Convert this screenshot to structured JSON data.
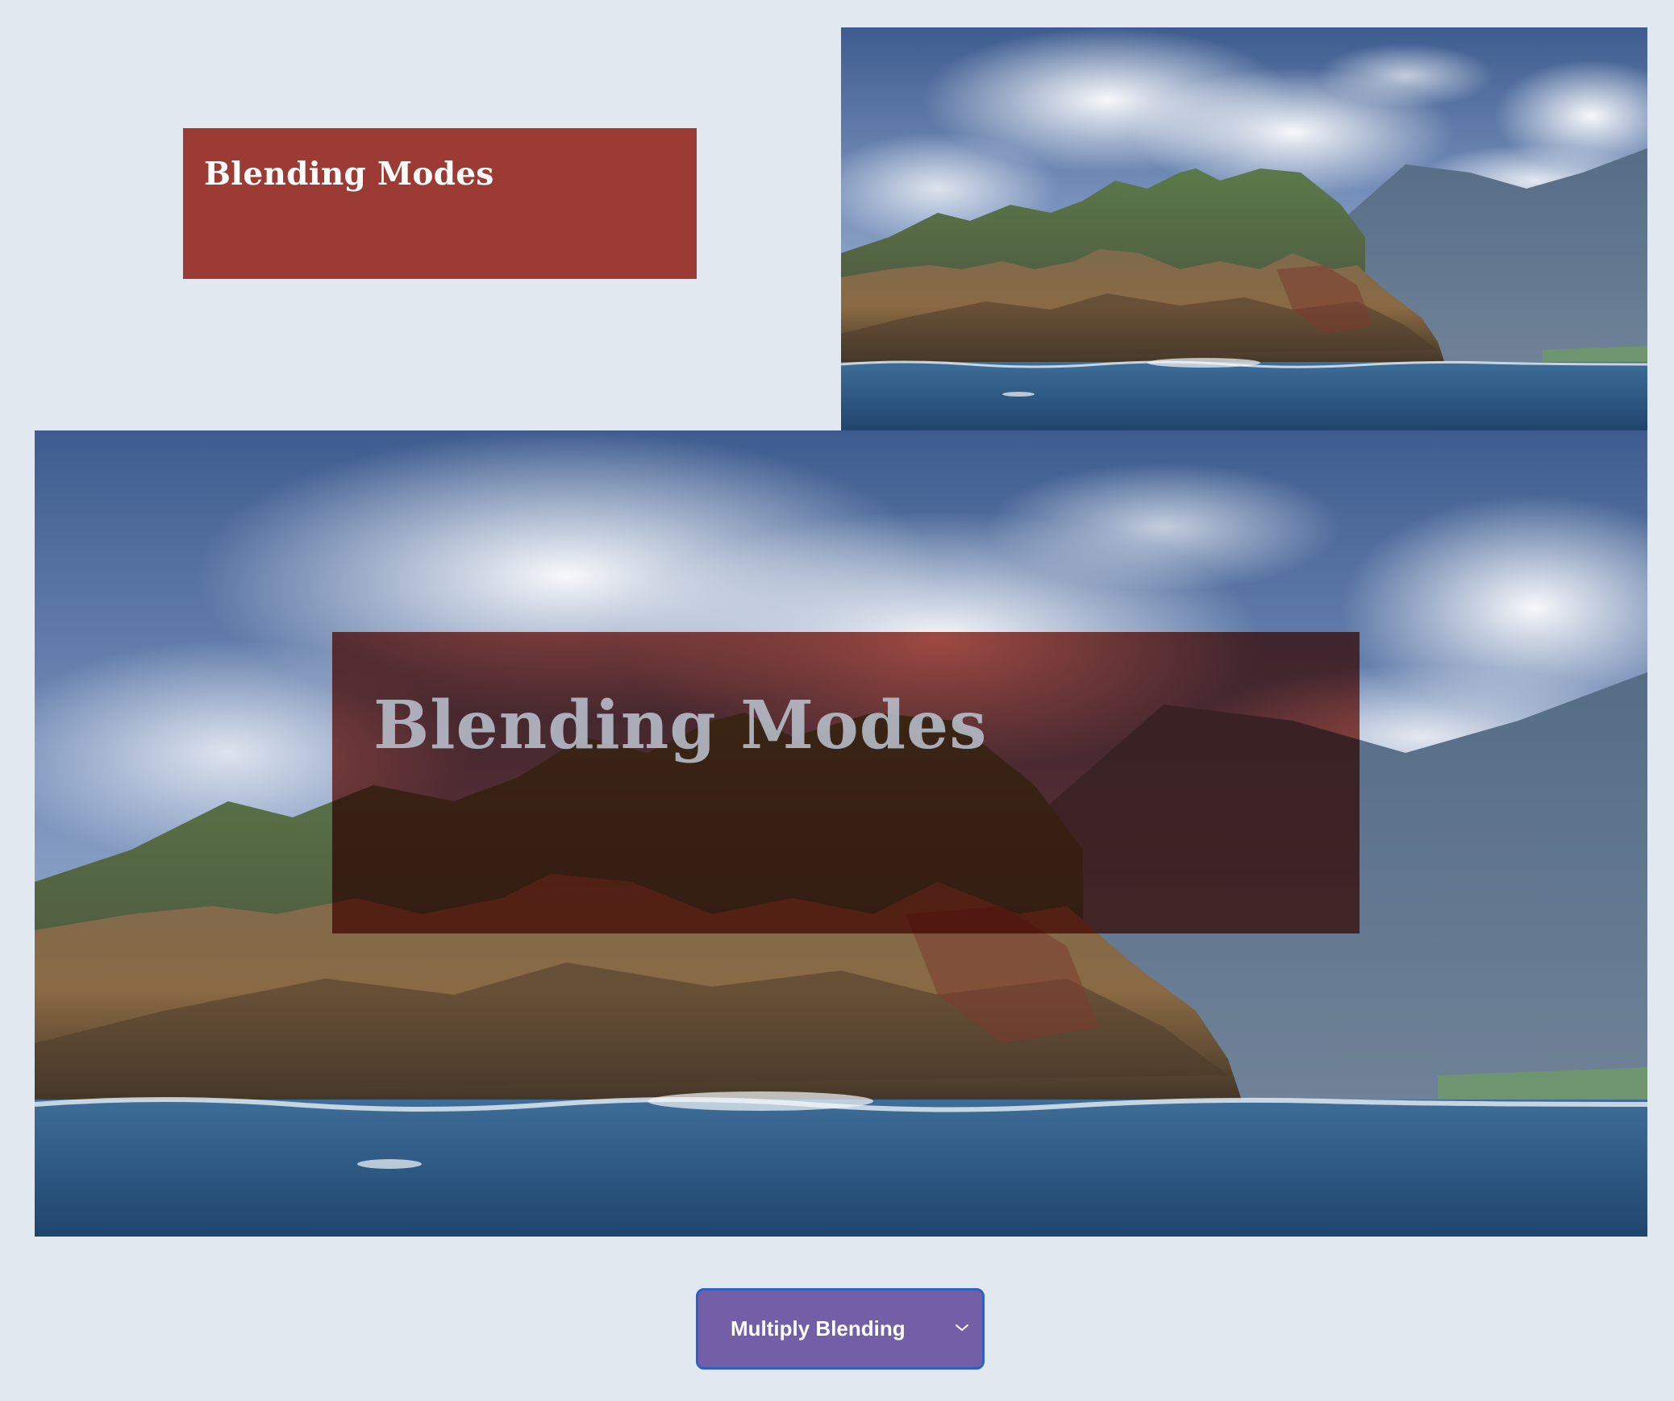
{
  "title_card": {
    "title": "Blending Modes",
    "color": "#9b3b33"
  },
  "hero_overlay": {
    "title": "Blending Modes",
    "blend_mode": "multiply"
  },
  "blend_select": {
    "selected_label": "Multiply Blending",
    "background_color": "#735ea8",
    "border_color": "#2f5fc4",
    "icon": "chevron-down-icon"
  },
  "colors": {
    "page_background": "#e2e8ef",
    "accent_red": "#9b3b33"
  }
}
